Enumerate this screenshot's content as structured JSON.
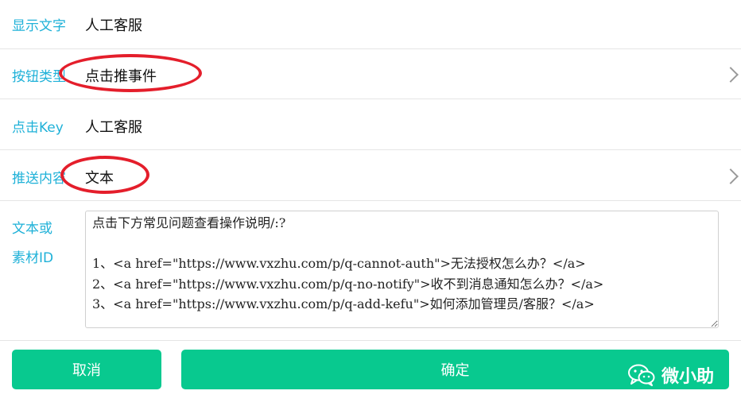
{
  "form": {
    "display_text": {
      "label": "显示文字",
      "value": "人工客服"
    },
    "button_type": {
      "label": "按钮类型",
      "value": "点击推事件"
    },
    "click_key": {
      "label": "点击Key",
      "value": "人工客服"
    },
    "push_content": {
      "label": "推送内容",
      "value": "文本"
    },
    "text_material": {
      "label_line1": "文本或",
      "label_line2": "素材ID",
      "value": "点击下方常见问题查看操作说明/:?\n\n1、<a href=\"https://www.vxzhu.com/p/q-cannot-auth\">无法授权怎么办？</a>\n2、<a href=\"https://www.vxzhu.com/p/q-no-notify\">收不到消息通知怎么办？</a>\n3、<a href=\"https://www.vxzhu.com/p/q-add-kefu\">如何添加管理员/客服？</a>"
    }
  },
  "buttons": {
    "cancel": "取消",
    "confirm": "确定"
  },
  "watermark": {
    "text": "微小助",
    "icon": "wechat-icon"
  },
  "colors": {
    "label": "#1fb1d8",
    "button": "#08c98f",
    "highlight_ring": "#e41e2b"
  }
}
